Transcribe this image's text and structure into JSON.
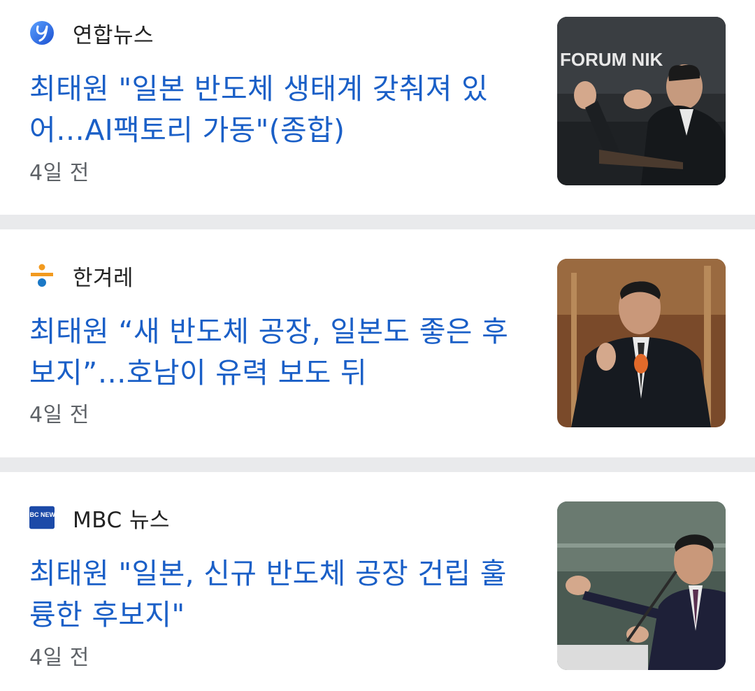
{
  "articles": [
    {
      "source": "연합뉴스",
      "source_icon": "yonhap-logo-icon",
      "headline": "최태원 \"일본 반도체 생태계 갖춰져 있어…AI팩토리 가동\"(종합)",
      "time": "4일 전",
      "thumbnail_caption": "FORUM NIK"
    },
    {
      "source": "한겨레",
      "source_icon": "hankyoreh-logo-icon",
      "headline": "최태원 “새 반도체 공장, 일본도 좋은 후보지”…호남이 유력 보도 뒤",
      "time": "4일 전"
    },
    {
      "source": "MBC 뉴스",
      "source_icon": "mbc-news-logo-icon",
      "headline": "최태원 \"일본, 신규 반도체 공장 건립 훌륭한 후보지\"",
      "time": "4일 전",
      "logo_text": "MBC NEWS"
    }
  ],
  "colors": {
    "headline": "#1a5fc7",
    "divider": "#e9eaec",
    "time": "#5f6368"
  }
}
